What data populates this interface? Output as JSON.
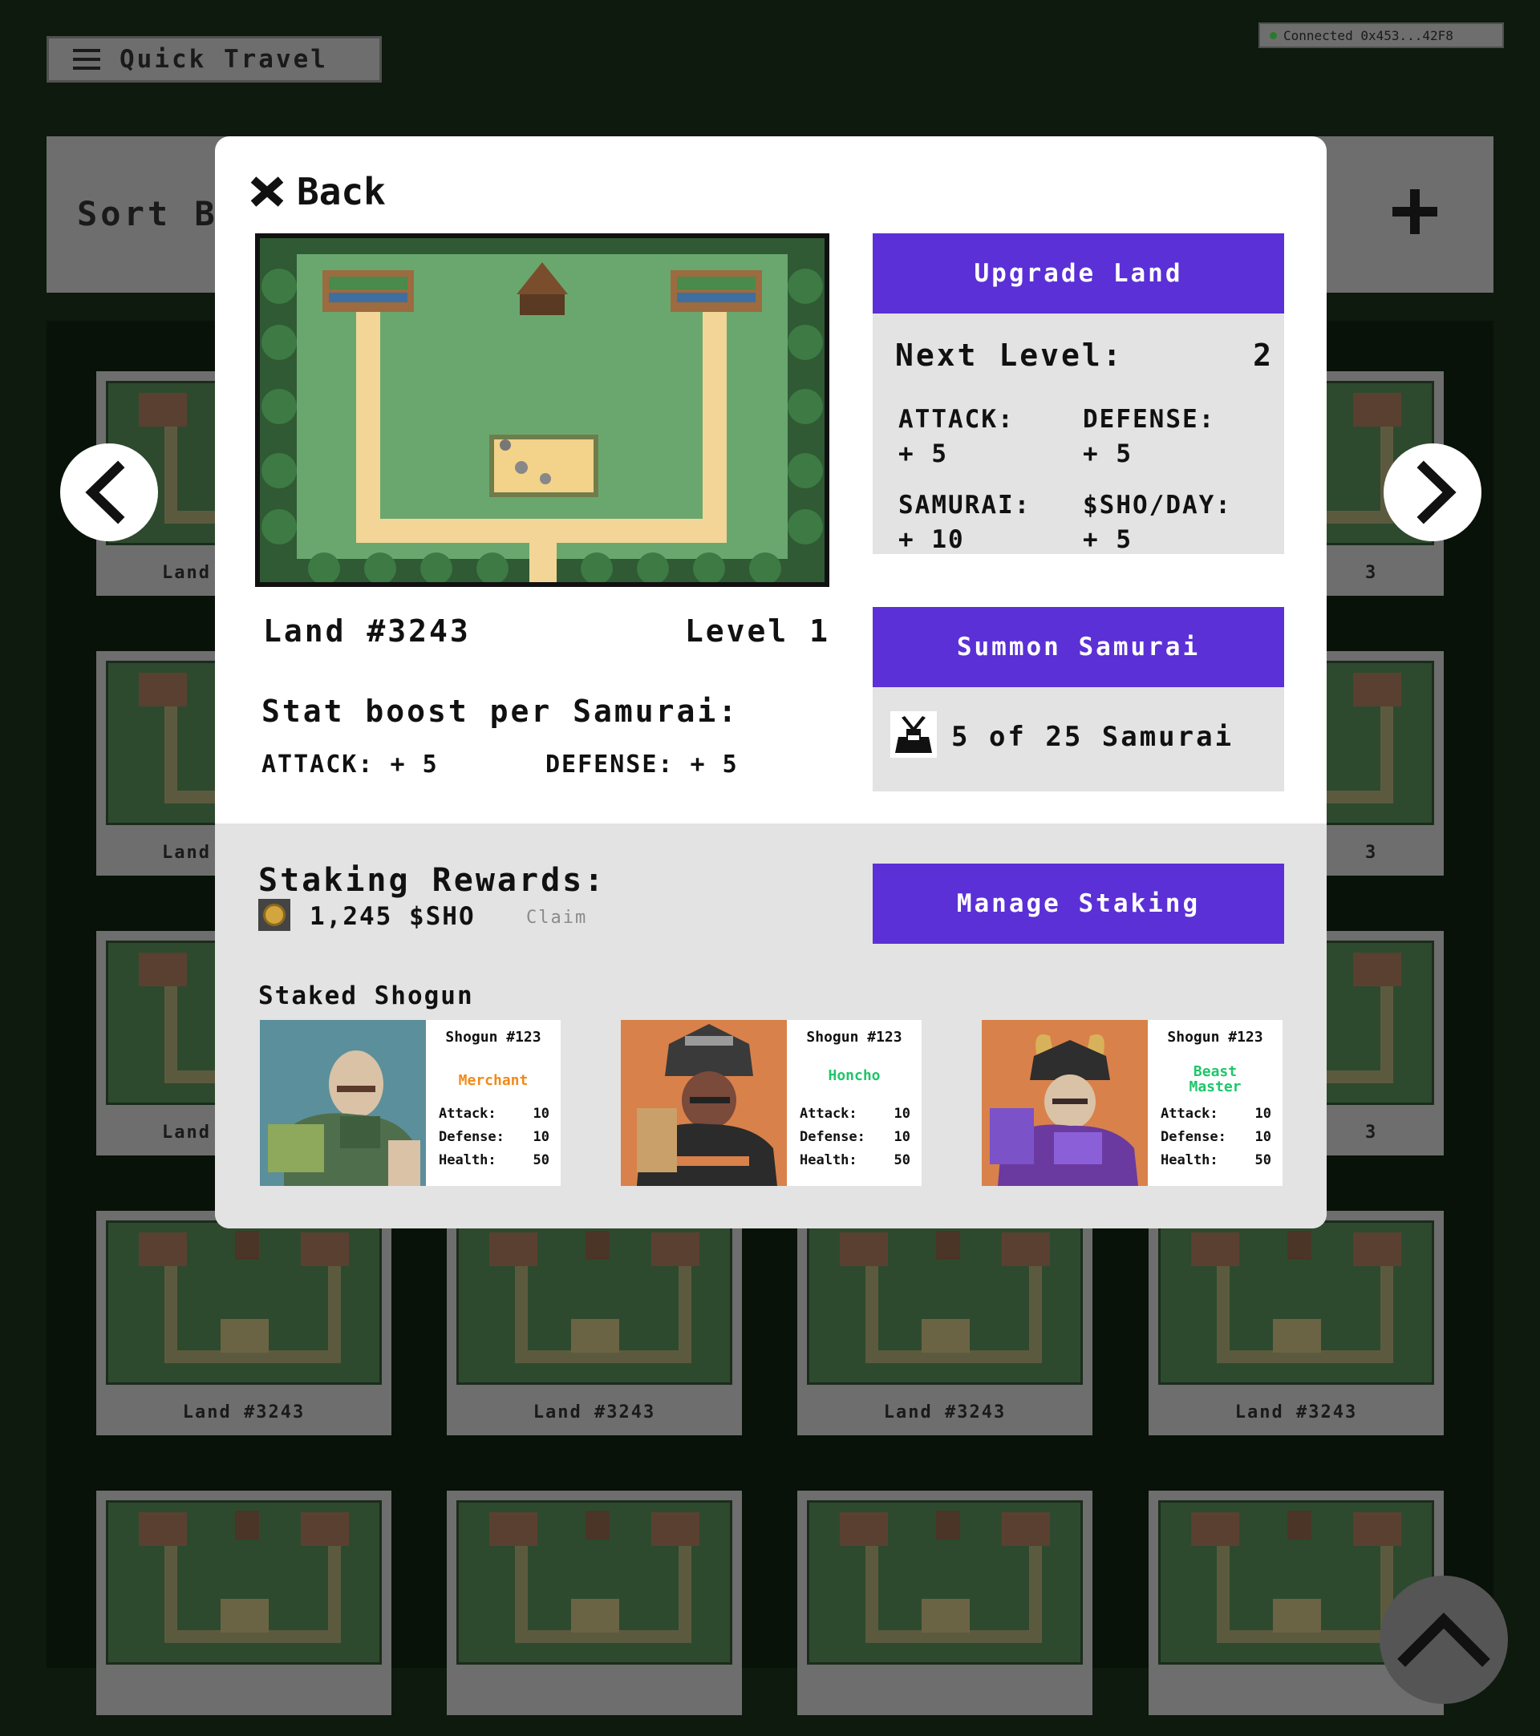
{
  "nav": {
    "quick_travel_label": "Quick Travel"
  },
  "wallet": {
    "status": "Connected 0x453...42F8"
  },
  "sort": {
    "label": "Sort B"
  },
  "land_grid": {
    "items": [
      {
        "label": "Land #3243"
      },
      {
        "label": "Land #3243"
      },
      {
        "label": "Land #3243"
      },
      {
        "label": "Land #3243"
      },
      {
        "label": "Land #3243"
      },
      {
        "label": "Land #3243"
      },
      {
        "label": "Land #3243"
      },
      {
        "label": "Land #3243"
      }
    ],
    "partial_left_label": "Land",
    "partial_right_label": "3"
  },
  "modal": {
    "back_label": "Back",
    "land_title": "Land #3243",
    "land_level": "Level 1",
    "boost_title": "Stat boost per Samurai:",
    "boost_attack": "ATTACK: + 5",
    "boost_defense": "DEFENSE: + 5",
    "upgrade_label": "Upgrade Land",
    "next_level_label": "Next Level:",
    "next_level_value": "2",
    "next_stats": {
      "attack_label": "ATTACK:",
      "attack_value": "+ 5",
      "defense_label": "DEFENSE:",
      "defense_value": "+ 5",
      "samurai_label": "SAMURAI:",
      "samurai_value": "+ 10",
      "sho_label": "$SHO/DAY:",
      "sho_value": "+ 5"
    },
    "summon_label": "Summon Samurai",
    "samurai_count": "5 of 25 Samurai",
    "rewards_title": "Staking Rewards:",
    "rewards_amount": "1,245 $SHO",
    "claim_label": "Claim",
    "manage_staking_label": "Manage Staking",
    "staked_title": "Staked Shogun",
    "shoguns": [
      {
        "name": "Shogun #123",
        "role": "Merchant",
        "role_color": "#f08a1a",
        "attack_label": "Attack:",
        "attack": "10",
        "defense_label": "Defense:",
        "defense": "10",
        "health_label": "Health:",
        "health": "50"
      },
      {
        "name": "Shogun #123",
        "role": "Honcho",
        "role_color": "#1fc66a",
        "attack_label": "Attack:",
        "attack": "10",
        "defense_label": "Defense:",
        "defense": "10",
        "health_label": "Health:",
        "health": "50"
      },
      {
        "name": "Shogun #123",
        "role": "Beast Master",
        "role_color": "#1fc66a",
        "attack_label": "Attack:",
        "attack": "10",
        "defense_label": "Defense:",
        "defense": "10",
        "health_label": "Health:",
        "health": "50"
      }
    ]
  },
  "colors": {
    "accent_purple": "#5b30d6",
    "page_background": "#0d1a0d",
    "panel_gray": "#e3e3e3"
  },
  "icons": {
    "menu": "hamburger-icon",
    "back": "close-icon",
    "add": "plus-icon",
    "prev": "chevron-left-icon",
    "next": "chevron-right-icon",
    "scroll_top": "chevron-up-icon",
    "samurai": "samurai-helmet-icon",
    "coin": "coin-icon"
  }
}
